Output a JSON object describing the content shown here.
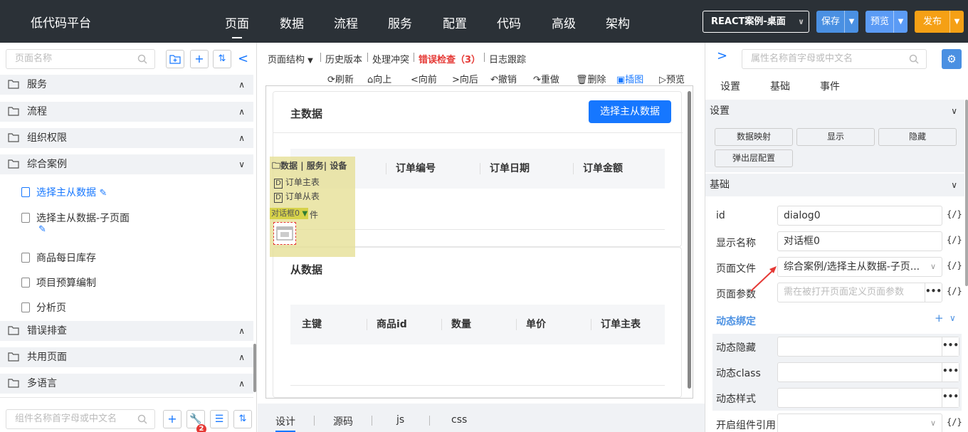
{
  "app_title": "低代码平台",
  "top_nav": [
    "页面",
    "数据",
    "流程",
    "服务",
    "配置",
    "代码",
    "高级",
    "架构"
  ],
  "project_select": "REACT案例-桌面",
  "top_buttons": {
    "save": "保存",
    "preview": "预览",
    "publish": "发布"
  },
  "colors": {
    "accent": "#1677ff",
    "save_btn": "#4a90e2",
    "preview_btn": "#5b9bf5",
    "publish_btn": "#f5a015",
    "error": "#e53935"
  },
  "left": {
    "search_placeholder": "页面名称",
    "groups": [
      {
        "label": "服务",
        "chev": "∧"
      },
      {
        "label": "流程",
        "chev": "∧"
      },
      {
        "label": "组织权限",
        "chev": "∧"
      },
      {
        "label": "综合案例",
        "chev": "∨"
      },
      {
        "label": "错误排查",
        "chev": "∧"
      },
      {
        "label": "共用页面",
        "chev": "∧"
      },
      {
        "label": "多语言",
        "chev": "∧"
      }
    ],
    "pages": [
      "选择主从数据",
      "选择主从数据-子页面",
      "商品每日库存",
      "项目预算编制",
      "分析页"
    ],
    "component_search_placeholder": "组件名称首字母或中文名",
    "badge_count": "2"
  },
  "center": {
    "tabs": [
      "页面结构",
      "历史版本",
      "处理冲突",
      "错误检查（3）",
      "日志跟踪"
    ],
    "toolbar": [
      "刷新",
      "向上",
      "向前",
      "向后",
      "撤销",
      "重做",
      "删除",
      "插图",
      "预览"
    ],
    "master_title": "主数据",
    "select_button": "选择主从数据",
    "master_columns": [
      "订单编号",
      "订单日期",
      "订单金额"
    ],
    "detail_title": "从数据",
    "detail_columns": [
      "主键",
      "商品id",
      "数量",
      "单价",
      "订单主表"
    ],
    "overlay": {
      "header": "数据 | 服务| 设备",
      "items": [
        "订单主表",
        "订单从表"
      ],
      "dialog_tag": "对话框0",
      "partial_text": "件"
    },
    "bottom_tabs": [
      "设计",
      "源码",
      "js",
      "css"
    ]
  },
  "right": {
    "search_placeholder": "属性名称首字母或中文名",
    "tabs": [
      "设置",
      "基础",
      "事件"
    ],
    "section_settings": "设置",
    "setting_buttons": [
      "数据映射",
      "显示",
      "隐藏",
      "弹出层配置"
    ],
    "section_basic": "基础",
    "props": {
      "id_label": "id",
      "id_value": "dialog0",
      "display_name_label": "显示名称",
      "display_name_value": "对话框0",
      "page_file_label": "页面文件",
      "page_file_value": "综合案例/选择主从数据-子页...",
      "page_params_label": "页面参数",
      "page_params_placeholder": "需在被打开页面定义页面参数"
    },
    "dynamic_binding": "动态绑定",
    "dynamic_rows": [
      "动态隐藏",
      "动态class",
      "动态样式"
    ],
    "component_ref": "开启组件引用",
    "curly": "{/}"
  }
}
